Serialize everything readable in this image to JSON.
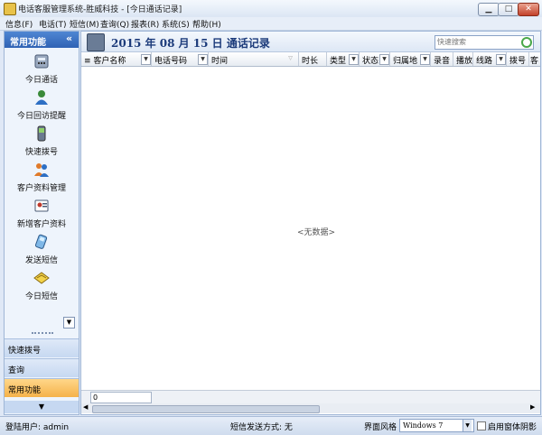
{
  "window": {
    "title": "电话客服管理系统-胜威科技 - [今日通话记录]",
    "min_label": "▁",
    "max_label": "□",
    "close_label": "✕"
  },
  "menu": [
    "信息(F)",
    "电话(T)",
    "短信(M)",
    "查询(Q)",
    "报表(R)",
    "系统(S)",
    "帮助(H)"
  ],
  "sidebar": {
    "header": "常用功能",
    "collapse": "«",
    "items": [
      {
        "label": "今日通话",
        "icon": "phone-icon"
      },
      {
        "label": "今日回访提醒",
        "icon": "person-reminder-icon"
      },
      {
        "label": "快速拨号",
        "icon": "mobile-phone-icon"
      },
      {
        "label": "客户资料管理",
        "icon": "customers-icon"
      },
      {
        "label": "新增客户资料",
        "icon": "add-customer-icon"
      },
      {
        "label": "发送短信",
        "icon": "send-sms-icon"
      },
      {
        "label": "今日短信",
        "icon": "sms-envelope-icon"
      }
    ],
    "more": "▼",
    "tabs": [
      "快速拨号",
      "查询",
      "常用功能"
    ],
    "bottom_arrow": "▼"
  },
  "page": {
    "title": "2015 年 08 月 15 日 通话记录",
    "search_placeholder": "快速搜索"
  },
  "grid": {
    "columns": [
      "客户名称",
      "电话号码",
      "时间",
      "时长",
      "类型",
      "状态",
      "归属地",
      "录音",
      "播放",
      "线路",
      "拨号",
      "客"
    ],
    "empty_text": "<无数据>",
    "footer_count": "0"
  },
  "status": {
    "user": "登陆用户: admin",
    "sms": "短信发送方式: 无",
    "style_label": "界面风格",
    "style_value": "Windows 7",
    "shadow_label": "启用窗体阴影"
  },
  "colors": {
    "accent": "#2f62b4",
    "active_tab": "#f5b24a",
    "title_text": "#1b3a7a"
  }
}
